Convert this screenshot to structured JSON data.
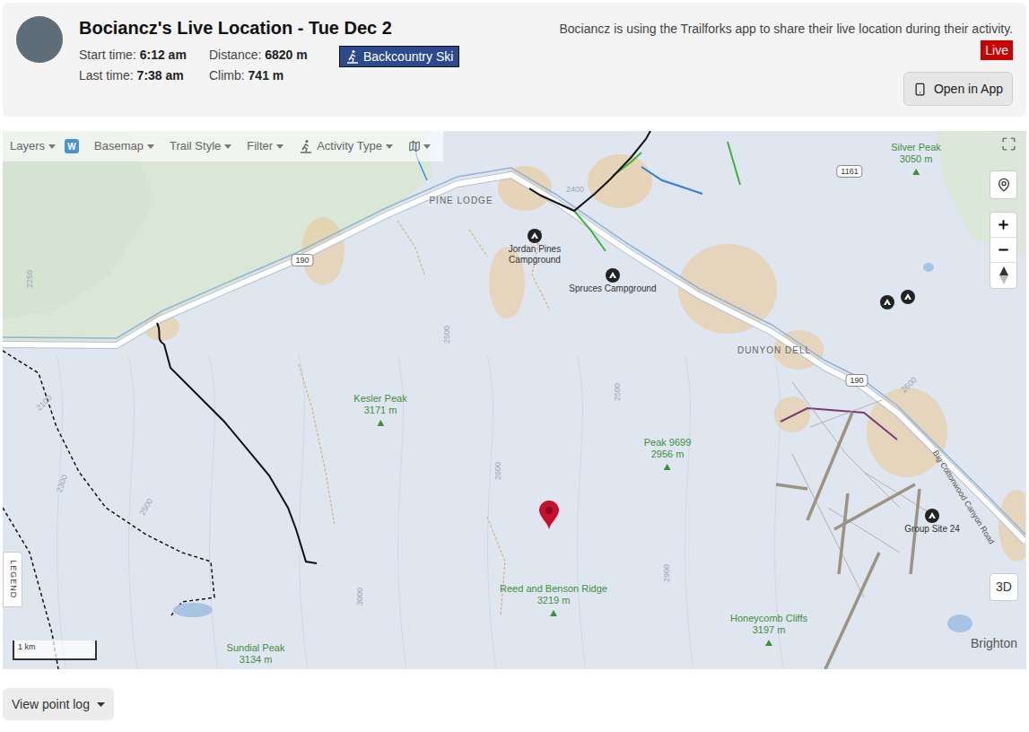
{
  "header": {
    "title": "Bociancz's Live Location - Tue Dec 2",
    "stats": [
      {
        "label": "Start time:",
        "value": "6:12 am"
      },
      {
        "label": "Distance:",
        "value": "6820 m"
      },
      {
        "label": "Last time:",
        "value": "7:38 am"
      },
      {
        "label": "Climb:",
        "value": "741 m"
      }
    ],
    "activity": "Backcountry Ski",
    "share_note": "Bociancz is using the Trailforks app to share their live location during their activity.",
    "live_badge": "Live",
    "open_app_button": "Open in App"
  },
  "map": {
    "toolbar": [
      {
        "label": "Layers",
        "badge": "W"
      },
      {
        "label": "Basemap"
      },
      {
        "label": "Trail Style"
      },
      {
        "label": "Filter"
      },
      {
        "label": "Activity Type"
      }
    ],
    "peaks": [
      {
        "name": "Kesler Peak",
        "elevation": "3171 m"
      },
      {
        "name": "Peak 9699",
        "elevation": "2956 m"
      },
      {
        "name": "Reed and Benson Ridge",
        "elevation": "3219 m"
      },
      {
        "name": "Honeycomb Cliffs",
        "elevation": "3197 m"
      },
      {
        "name": "Sundial Peak",
        "elevation": "3134 m"
      },
      {
        "name": "Silver Peak",
        "elevation": "3050 m"
      }
    ],
    "places": [
      {
        "name": "PINE LODGE",
        "kind": "locality"
      },
      {
        "name": "DUNYON DELL",
        "kind": "locality"
      },
      {
        "name": "Brighton",
        "kind": "town"
      }
    ],
    "campgrounds": [
      "Jordan Pines Campground",
      "Spruces Campground",
      "Group Site 24"
    ],
    "road_shields": [
      "190",
      "190",
      "1161"
    ],
    "road_label": "Big Cottonwood Canyon Road",
    "contours": [
      "2250",
      "2100",
      "2300",
      "2500",
      "2500",
      "2500",
      "2600",
      "3000",
      "2900",
      "2400",
      "2600"
    ],
    "scale": "1 km",
    "legend": "LEGEND",
    "view_3d": "3D"
  },
  "point_log_button": "View point log"
}
